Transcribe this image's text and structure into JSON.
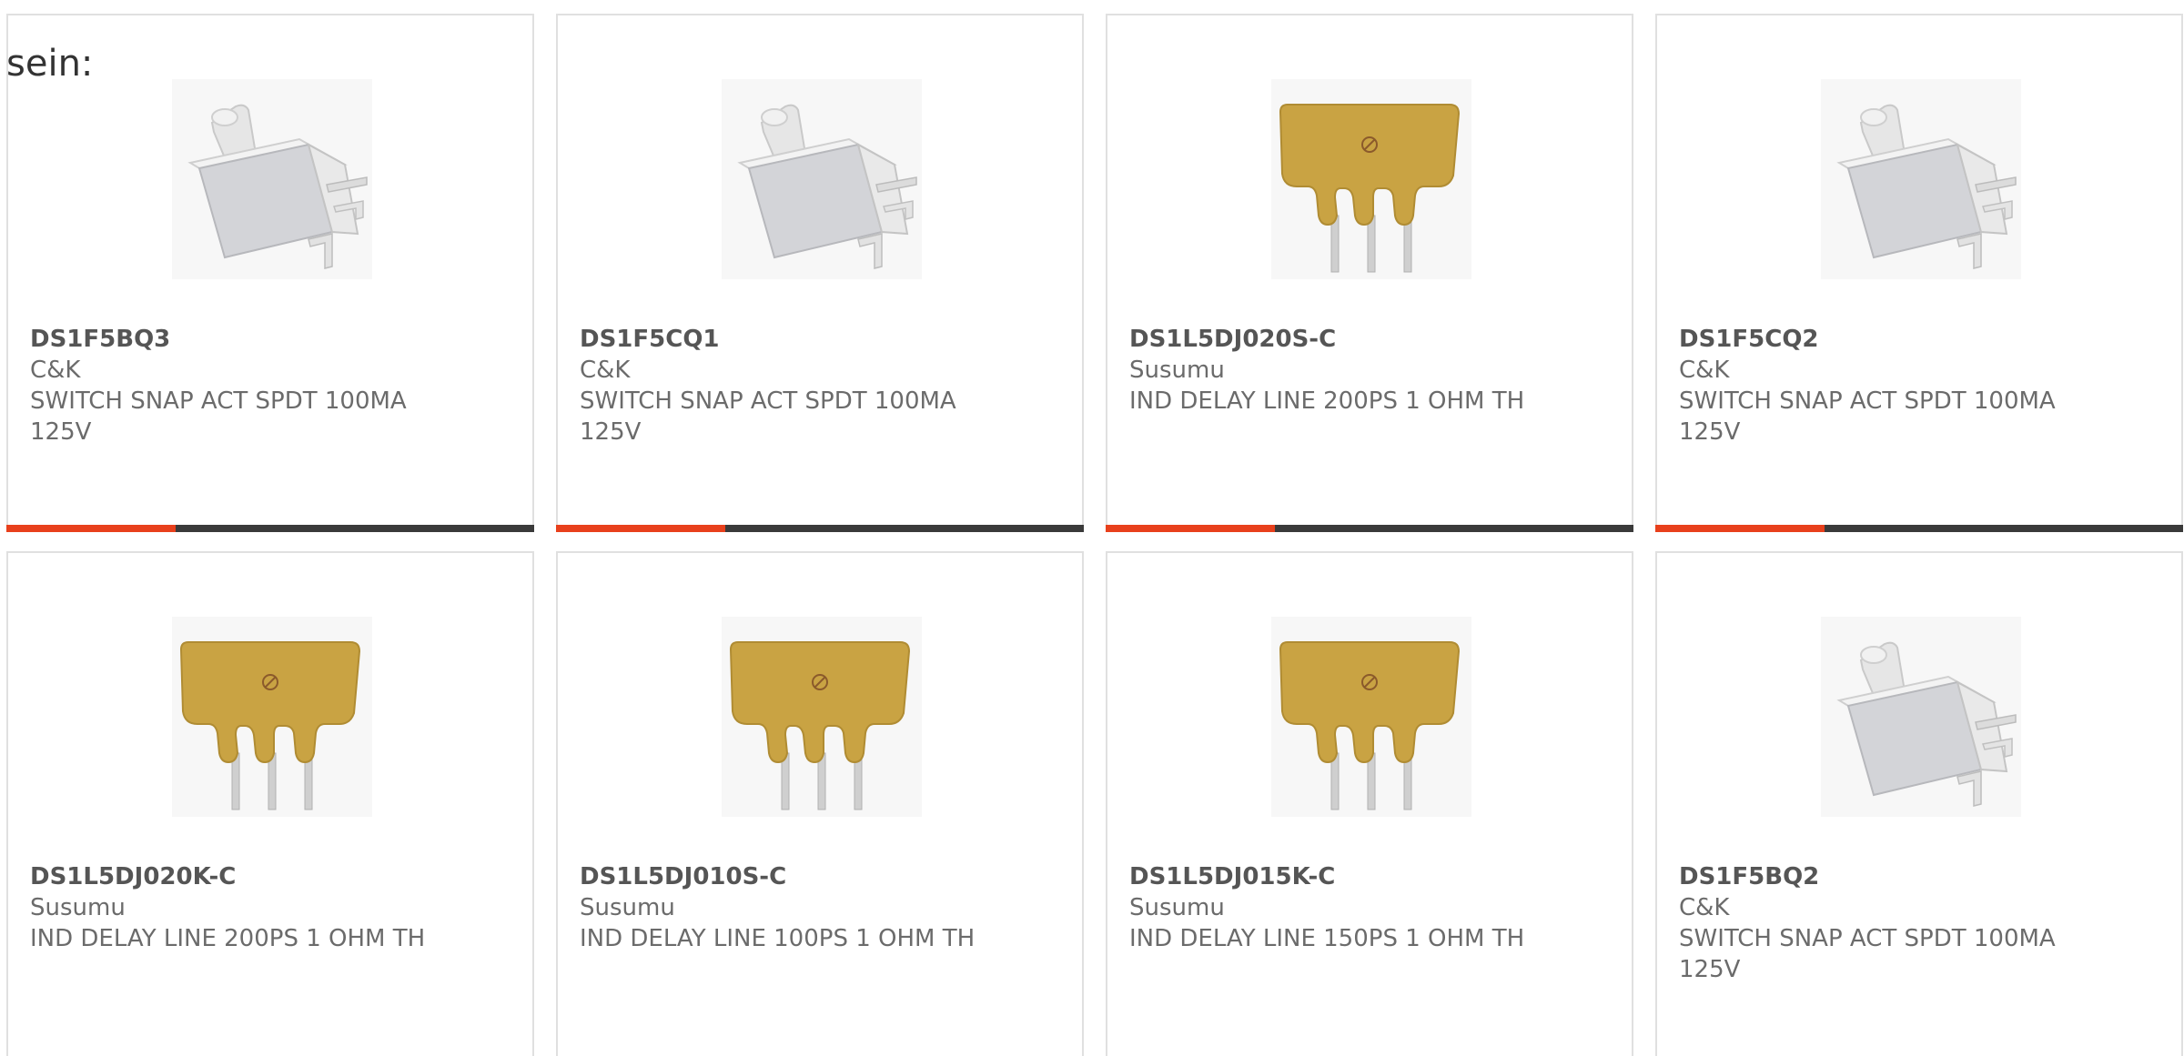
{
  "intro": {
    "text": "sein:"
  },
  "colors": {
    "accent": "#e8401c",
    "bar": "#3a3a3a"
  },
  "products": [
    {
      "part": "DS1F5BQ3",
      "maker": "C&K",
      "desc": "SWITCH SNAP ACT SPDT 100MA 125V",
      "image": "snap-switch",
      "bar_accent_fraction": 0.32
    },
    {
      "part": "DS1F5CQ1",
      "maker": "C&K",
      "desc": "SWITCH SNAP ACT SPDT 100MA 125V",
      "image": "snap-switch",
      "bar_accent_fraction": 0.32
    },
    {
      "part": "DS1L5DJ020S-C",
      "maker": "Susumu",
      "desc": "IND DELAY LINE 200PS 1 OHM TH",
      "image": "delay-line",
      "bar_accent_fraction": 0.32
    },
    {
      "part": "DS1F5CQ2",
      "maker": "C&K",
      "desc": "SWITCH SNAP ACT SPDT 100MA 125V",
      "image": "snap-switch",
      "bar_accent_fraction": 0.32
    },
    {
      "part": "DS1L5DJ020K-C",
      "maker": "Susumu",
      "desc": "IND DELAY LINE 200PS 1 OHM TH",
      "image": "delay-line",
      "bar_accent_fraction": 0
    },
    {
      "part": "DS1L5DJ010S-C",
      "maker": "Susumu",
      "desc": "IND DELAY LINE 100PS 1 OHM TH",
      "image": "delay-line",
      "bar_accent_fraction": 0
    },
    {
      "part": "DS1L5DJ015K-C",
      "maker": "Susumu",
      "desc": "IND DELAY LINE 150PS 1 OHM TH",
      "image": "delay-line",
      "bar_accent_fraction": 0
    },
    {
      "part": "DS1F5BQ2",
      "maker": "C&K",
      "desc": "SWITCH SNAP ACT SPDT 100MA 125V",
      "image": "snap-switch",
      "bar_accent_fraction": 0
    }
  ]
}
